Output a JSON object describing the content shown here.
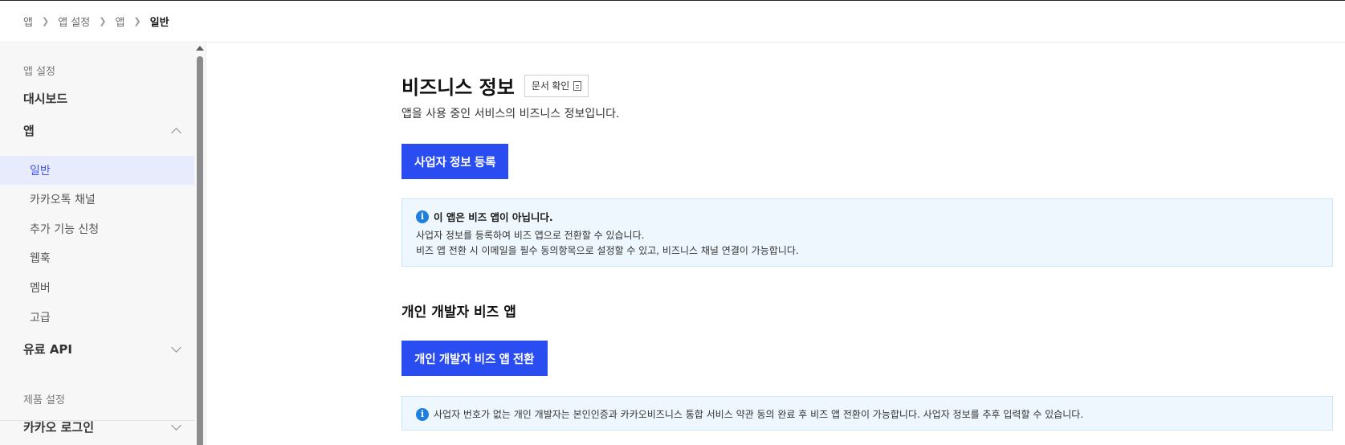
{
  "breadcrumb": {
    "items": [
      "앱",
      "앱 설정",
      "앱"
    ],
    "current": "일반",
    "separator_icon": "chevron-right-icon"
  },
  "sidebar": {
    "group1_label": "앱 설정",
    "dashboard": "대시보드",
    "app": {
      "label": "앱",
      "expanded": true
    },
    "app_items": [
      "일반",
      "카카오톡 채널",
      "추가 기능 신청",
      "웹훅",
      "멤버",
      "고급"
    ],
    "active_item": "일반",
    "paid_api": {
      "label": "유료 API",
      "expanded": false
    },
    "group2_label": "제품 설정",
    "kakao_login": {
      "label": "카카오 로그인",
      "expanded": false
    }
  },
  "main": {
    "title": "비즈니스 정보",
    "doc_button": "문서 확인",
    "subtitle": "앱을 사용 중인 서비스의 비즈니스 정보입니다.",
    "register_button": "사업자 정보 등록",
    "notice": {
      "title": "이 앱은 비즈 앱이 아닙니다.",
      "line1": "사업자 정보를 등록하여 비즈 앱으로 전환할 수 있습니다.",
      "line2": "비즈 앱 전환 시 이메일을 필수 동의항목으로 설정할 수 있고, 비즈니스 채널 연결이 가능합니다."
    },
    "individual_section_title": "개인 개발자 비즈 앱",
    "individual_button": "개인 개발자 비즈 앱 전환",
    "individual_notice": "사업자 번호가 없는 개인 개발자는 본인인증과 카카오비즈니스 통합 서비스 약관 동의 완료 후 비즈 앱 전환이 가능합니다. 사업자 정보를 추후 입력할 수 있습니다."
  },
  "colors": {
    "primary": "#2a4df2",
    "active_bg": "#e8ebfb",
    "active_text": "#3c54e8",
    "info_bg": "#eef7fd",
    "info_icon": "#1f7fde"
  }
}
